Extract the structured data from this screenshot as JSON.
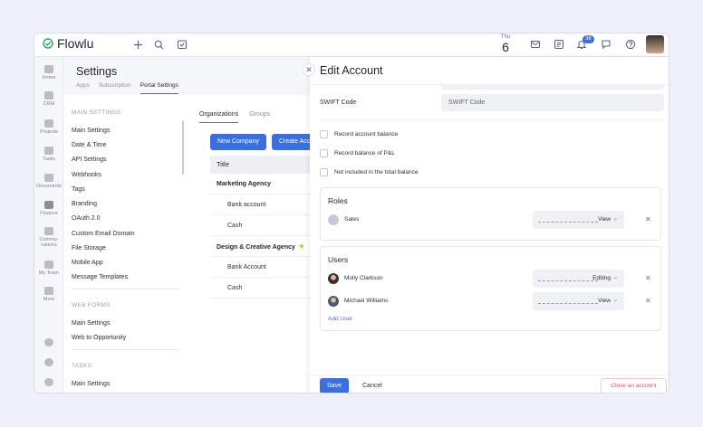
{
  "app": {
    "name": "Flowlu"
  },
  "topbar": {
    "date_day": "Thu",
    "date_num": "6",
    "notifications_count": "38",
    "icons": [
      "plus-icon",
      "search-icon",
      "task-check-icon",
      "mail-icon",
      "note-icon",
      "bell-icon",
      "chat-icon",
      "help-icon"
    ]
  },
  "rail": {
    "items": [
      {
        "label": "Home",
        "icon": "home-icon"
      },
      {
        "label": "CRM",
        "icon": "crm-icon"
      },
      {
        "label": "Projects",
        "icon": "projects-icon"
      },
      {
        "label": "Tasks",
        "icon": "tasks-icon"
      },
      {
        "label": "Documents",
        "icon": "documents-icon"
      },
      {
        "label": "Finance",
        "icon": "finance-icon"
      },
      {
        "label": "Commu-",
        "label2": "cations",
        "icon": "communications-icon"
      },
      {
        "label": "My Team",
        "icon": "team-icon"
      },
      {
        "label": "More",
        "icon": "more-icon"
      }
    ]
  },
  "settings": {
    "title": "Settings",
    "tabs": [
      "Apps",
      "Subscription",
      "Portal Settings"
    ],
    "sections": {
      "main": "MAIN SETTINGS",
      "web_forms": "WEB FORMS",
      "tasks": "TASKS"
    },
    "main_items": [
      "Main Settings",
      "Date & Time",
      "API Settings",
      "Webhooks",
      "Tags",
      "Branding",
      "OAuth 2.0",
      "Custom Email Domain",
      "File Storage",
      "Mobile App",
      "Message Templates"
    ],
    "web_form_items": [
      "Main Settings",
      "Web to Opportunity"
    ],
    "task_items": [
      "Main Settings"
    ]
  },
  "orgs": {
    "tabs": [
      "Organizations",
      "Groups"
    ],
    "new_button": "New Company",
    "create_button": "Create Acc",
    "table_header": "Title",
    "rows": [
      {
        "text": "Marketing Agency",
        "kind": "group"
      },
      {
        "text": "Bank account",
        "kind": "sub"
      },
      {
        "text": "Cash",
        "kind": "sub"
      },
      {
        "text": "Design & Creative Agency",
        "kind": "group",
        "starred": true
      },
      {
        "text": "Bank Account",
        "kind": "sub"
      },
      {
        "text": "Cash",
        "kind": "sub"
      }
    ]
  },
  "modal": {
    "title": "Edit Account",
    "swift_label": "SWIFT Code",
    "swift_placeholder": "SWIFT Code",
    "checkboxes": [
      "Record account balance",
      "Record balance of P&L",
      "Not included in the total balance"
    ],
    "roles": {
      "title": "Roles",
      "items": [
        {
          "name": "Sales",
          "permission": "View"
        }
      ]
    },
    "users": {
      "title": "Users",
      "items": [
        {
          "name": "Molly Clarkson",
          "permission": "Editing"
        },
        {
          "name": "Michael Williams",
          "permission": "View"
        }
      ],
      "add_label": "Add User"
    },
    "footer": {
      "save": "Save",
      "cancel": "Cancel",
      "close_account": "Close an account"
    }
  },
  "colors": {
    "accent": "#3b6fe0",
    "danger": "#d9525e",
    "star": "#f3b720"
  }
}
